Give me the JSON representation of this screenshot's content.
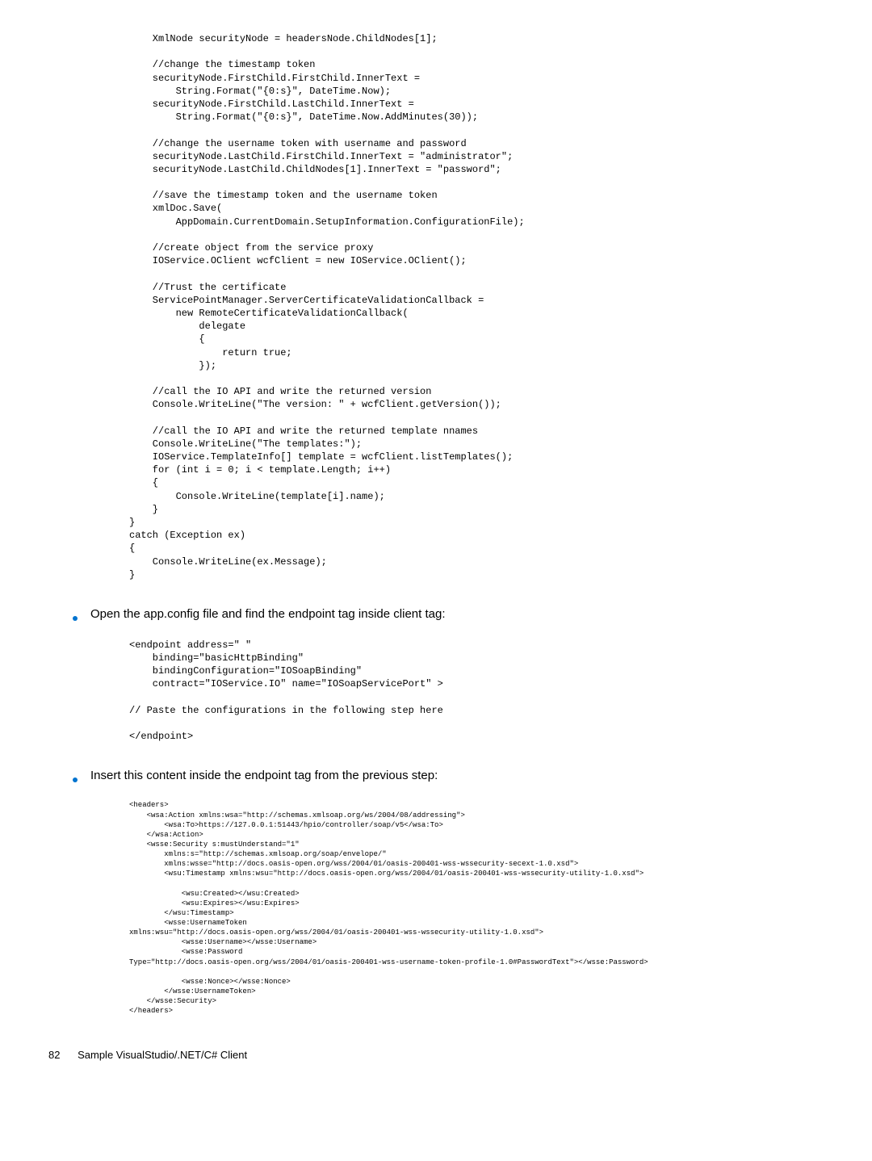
{
  "code1": "    XmlNode securityNode = headersNode.ChildNodes[1];\n\n    //change the timestamp token\n    securityNode.FirstChild.FirstChild.InnerText =\n        String.Format(\"{0:s}\", DateTime.Now);\n    securityNode.FirstChild.LastChild.InnerText =\n        String.Format(\"{0:s}\", DateTime.Now.AddMinutes(30));\n\n    //change the username token with username and password\n    securityNode.LastChild.FirstChild.InnerText = \"administrator\";\n    securityNode.LastChild.ChildNodes[1].InnerText = \"password\";\n\n    //save the timestamp token and the username token\n    xmlDoc.Save(\n        AppDomain.CurrentDomain.SetupInformation.ConfigurationFile);\n\n    //create object from the service proxy\n    IOService.OClient wcfClient = new IOService.OClient();\n\n    //Trust the certificate\n    ServicePointManager.ServerCertificateValidationCallback =\n        new RemoteCertificateValidationCallback(\n            delegate\n            {\n                return true;\n            });\n\n    //call the IO API and write the returned version\n    Console.WriteLine(\"The version: \" + wcfClient.getVersion());\n\n    //call the IO API and write the returned template nnames\n    Console.WriteLine(\"The templates:\");\n    IOService.TemplateInfo[] template = wcfClient.listTemplates();\n    for (int i = 0; i < template.Length; i++)\n    {\n        Console.WriteLine(template[i].name);\n    }\n}\ncatch (Exception ex)\n{\n    Console.WriteLine(ex.Message);\n}",
  "bullet1": "Open the app.config file and find the endpoint tag inside client tag:",
  "code2": "<endpoint address=\" \"\n    binding=\"basicHttpBinding\"\n    bindingConfiguration=\"IOSoapBinding\"\n    contract=\"IOService.IO\" name=\"IOSoapServicePort\" >\n\n// Paste the configurations in the following step here\n\n</endpoint>",
  "bullet2": "Insert this content inside the endpoint tag from the previous step:",
  "code3": "<headers>\n    <wsa:Action xmlns:wsa=\"http://schemas.xmlsoap.org/ws/2004/08/addressing\">\n        <wsa:To>https://127.0.0.1:51443/hpio/controller/soap/v5</wsa:To>\n    </wsa:Action>\n    <wsse:Security s:mustUnderstand=\"1\"\n        xmlns:s=\"http://schemas.xmlsoap.org/soap/envelope/\"\n        xmlns:wsse=\"http://docs.oasis-open.org/wss/2004/01/oasis-200401-wss-wssecurity-secext-1.0.xsd\">\n        <wsu:Timestamp xmlns:wsu=\"http://docs.oasis-open.org/wss/2004/01/oasis-200401-wss-wssecurity-utility-1.0.xsd\">\n\n            <wsu:Created></wsu:Created>\n            <wsu:Expires></wsu:Expires>\n        </wsu:Timestamp>\n        <wsse:UsernameToken\nxmlns:wsu=\"http://docs.oasis-open.org/wss/2004/01/oasis-200401-wss-wssecurity-utility-1.0.xsd\">\n            <wsse:Username></wsse:Username>\n            <wsse:Password\nType=\"http://docs.oasis-open.org/wss/2004/01/oasis-200401-wss-username-token-profile-1.0#PasswordText\"></wsse:Password>\n\n            <wsse:Nonce></wsse:Nonce>\n        </wsse:UsernameToken>\n    </wsse:Security>\n</headers>",
  "footer": {
    "page": "82",
    "title": "Sample VisualStudio/.NET/C# Client"
  }
}
